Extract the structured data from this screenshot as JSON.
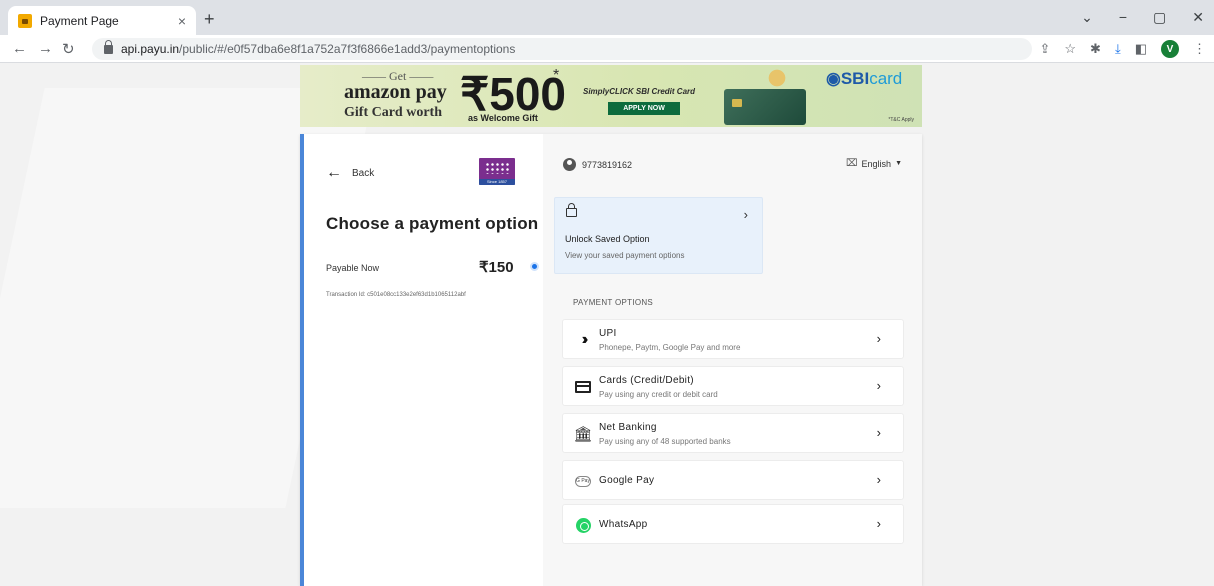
{
  "browser": {
    "tab_title": "Payment Page",
    "tab_close": "×",
    "new_tab": "+",
    "url_host": "api.payu.in",
    "url_path": "/public/#/e0f57dba6e8f1a752a7f3f6866e1add3/paymentoptions",
    "profile_initial": "V",
    "window_controls": [
      "⌄",
      "−",
      "▢",
      "✕"
    ]
  },
  "banner": {
    "get": "—— Get ——",
    "amazon_pay": "amazon pay",
    "gift_card_worth": "Gift Card worth",
    "amount": "₹500",
    "asterisk": "*",
    "as_welcome_gift": "as Welcome Gift",
    "simplyclick": "SimplyCLICK SBI Credit Card",
    "apply_now": "APPLY NOW",
    "sbi": "SBI",
    "card": "card",
    "tc_apply": "*T&C Apply"
  },
  "left": {
    "back_label": "Back",
    "merchant_since": "Since 1857",
    "heading": "Choose a payment option",
    "payable_label": "Payable Now",
    "payable_amount": "₹150",
    "transaction": "Transaction Id: c501e08cc133e2ef63d1b1065112abf"
  },
  "right": {
    "phone": "9773819162",
    "language": "English",
    "unlock_title": "Unlock Saved Option",
    "unlock_sub": "View your saved payment options",
    "section_heading": "PAYMENT OPTIONS",
    "options": [
      {
        "name": "UPI",
        "desc": "Phonepe, Paytm, Google Pay and more",
        "icon": "upi-icon"
      },
      {
        "name": "Cards (Credit/Debit)",
        "desc": "Pay using any credit or debit card",
        "icon": "card-icon"
      },
      {
        "name": "Net Banking",
        "desc": "Pay using any of 48 supported banks",
        "icon": "bank-icon"
      },
      {
        "name": "Google Pay",
        "desc": "",
        "icon": "google-pay-icon"
      },
      {
        "name": "WhatsApp",
        "desc": "",
        "icon": "whatsapp-icon"
      }
    ],
    "gpay_badge": "G Pay"
  },
  "colors": {
    "accent_blue": "#4b86d8",
    "unlock_bg": "#e8f1fb",
    "whatsapp_green": "#25d366"
  }
}
